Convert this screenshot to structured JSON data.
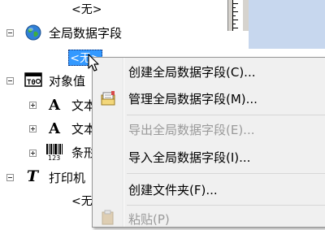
{
  "tree": {
    "items": [
      {
        "label": "<无>"
      },
      {
        "label": "全局数据字段"
      },
      {
        "label": "<无>"
      },
      {
        "label": "对象值"
      },
      {
        "label": "文本"
      },
      {
        "label": "文本"
      },
      {
        "label": "条形"
      },
      {
        "label": "打印机"
      },
      {
        "label": "<无>"
      }
    ]
  },
  "context_menu": {
    "items": [
      {
        "label": "创建全局数据字段(C)...",
        "enabled": true
      },
      {
        "label": "管理全局数据字段(M)...",
        "enabled": true
      },
      {
        "label": "导出全局数据字段(E)...",
        "enabled": false
      },
      {
        "label": "导入全局数据字段(I)...",
        "enabled": true
      },
      {
        "label": "创建文件夹(F)...",
        "enabled": true
      },
      {
        "label": "粘贴(P)",
        "enabled": false
      }
    ]
  }
}
